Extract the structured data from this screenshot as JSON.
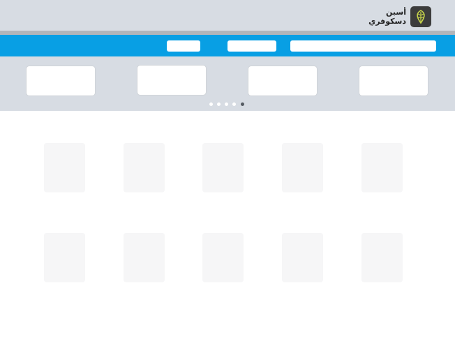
{
  "header": {
    "logo_line1": "أسبن",
    "logo_line2": "دسكوفري",
    "logo_icon": "leaf-icon",
    "colors": {
      "topbar": "#d7dce3",
      "bluebar": "#089fe4",
      "divider": "#b1b5ba"
    }
  },
  "nav": {
    "items": [
      "",
      "",
      ""
    ]
  },
  "carousel": {
    "cards": [
      "",
      "",
      "",
      ""
    ],
    "page_count": 5,
    "active_page": 5
  },
  "products": {
    "rows": [
      [
        "",
        "",
        "",
        "",
        ""
      ],
      [
        "",
        "",
        "",
        "",
        ""
      ]
    ]
  }
}
